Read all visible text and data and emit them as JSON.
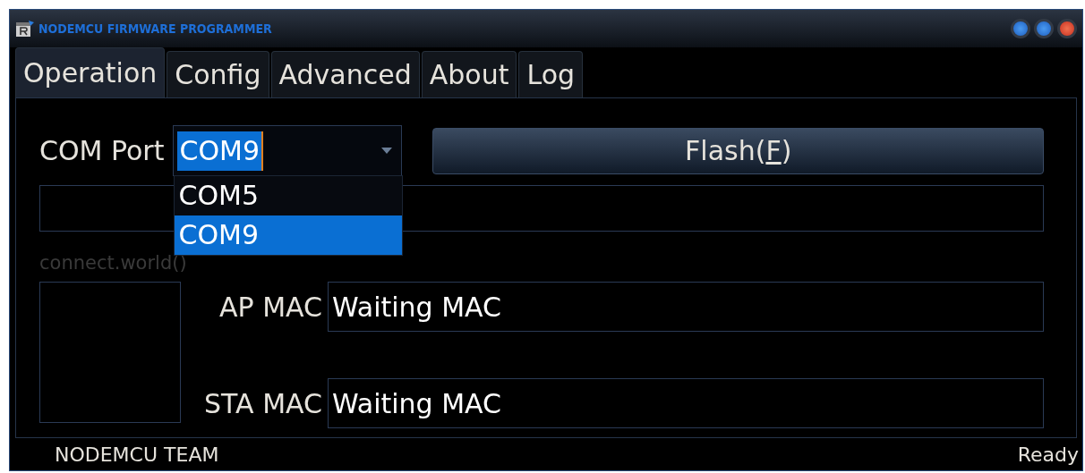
{
  "window": {
    "title": "NODEMCU FIRMWARE PROGRAMMER"
  },
  "tabs": [
    {
      "label": "Operation",
      "selected": true
    },
    {
      "label": "Config",
      "selected": false
    },
    {
      "label": "Advanced",
      "selected": false
    },
    {
      "label": "About",
      "selected": false
    },
    {
      "label": "Log",
      "selected": false
    }
  ],
  "com_port": {
    "label": "COM Port",
    "value": "COM9",
    "expanded": true,
    "options": [
      {
        "label": "COM5",
        "selected": false
      },
      {
        "label": "COM9",
        "selected": true
      }
    ]
  },
  "flash_button": {
    "label_before": "Flash(",
    "access_key": "F",
    "label_after": ")"
  },
  "connect_label": "connect.world()",
  "mac_fields": [
    {
      "label": "AP MAC",
      "value": "Waiting MAC"
    },
    {
      "label": "STA MAC",
      "value": "Waiting MAC"
    }
  ],
  "status_bar": {
    "left": "NODEMCU TEAM",
    "right": "Ready"
  }
}
